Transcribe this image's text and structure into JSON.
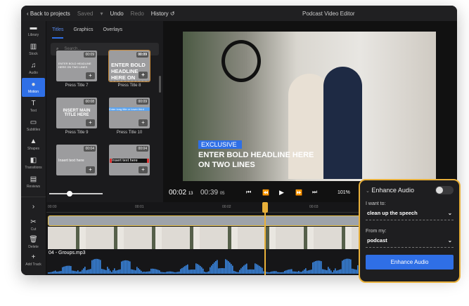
{
  "topbar": {
    "back": "Back to projects",
    "saved": "Saved",
    "undo": "Undo",
    "redo": "Redo",
    "history": "History",
    "title": "Podcast Video Editor"
  },
  "rail": [
    {
      "icon": "folder-icon",
      "glyph": "▬",
      "label": "Library"
    },
    {
      "icon": "books-icon",
      "glyph": "▥",
      "label": "Stock"
    },
    {
      "icon": "music-icon",
      "glyph": "♫",
      "label": "Audio"
    },
    {
      "icon": "motion-icon",
      "glyph": "●",
      "label": "Motion"
    },
    {
      "icon": "text-icon",
      "glyph": "T",
      "label": "Text"
    },
    {
      "icon": "subtitles-icon",
      "glyph": "▭",
      "label": "Subtitles"
    },
    {
      "icon": "shapes-icon",
      "glyph": "▲",
      "label": "Shapes"
    },
    {
      "icon": "transitions-icon",
      "glyph": "◧",
      "label": "Transitions"
    },
    {
      "icon": "reviews-icon",
      "glyph": "▤",
      "label": "Reviews"
    }
  ],
  "rail_bottom": [
    {
      "icon": "chevron-right-icon",
      "glyph": "›",
      "label": ""
    },
    {
      "icon": "scissors-icon",
      "glyph": "✂",
      "label": "Cut"
    },
    {
      "icon": "trash-icon",
      "glyph": "🗑",
      "label": "Delete"
    },
    {
      "icon": "add-track-icon",
      "glyph": "+",
      "label": "Add Track"
    }
  ],
  "panel": {
    "tabs": [
      "Titles",
      "Graphics",
      "Overlays"
    ],
    "search_placeholder": "Search...",
    "cards": [
      {
        "dur": "00:09",
        "name": "Press Title 7",
        "text": "ENTER BOLD HEADLINE HERE ON TWO LINES"
      },
      {
        "dur": "00:09",
        "name": "Press Title 8",
        "text": "ENTER BOLD HEADLINE HERE ON TWO LINES"
      },
      {
        "dur": "00:08",
        "name": "Press Title 9",
        "text": "INSERT MAIN TITLE HERE"
      },
      {
        "dur": "00:09",
        "name": "Press Title 10",
        "text": "Enter long title or lower third"
      },
      {
        "dur": "00:04",
        "name": "",
        "text": "Insert text here"
      },
      {
        "dur": "00:04",
        "name": "",
        "text": "Insert text here"
      }
    ]
  },
  "preview": {
    "badge": "EXCLUSIVE",
    "headline": "ENTER BOLD HEADLINE HERE ON TWO LINES",
    "time_current": "00:02",
    "time_current_frames": "13",
    "time_total": "00:39",
    "time_total_frames": "05",
    "zoom": "101%"
  },
  "timeline": {
    "ticks": [
      "00:00",
      "00:01",
      "00:02",
      "00:03"
    ],
    "audio_file": "04 - Groups.mp3"
  },
  "enhance": {
    "title": "Enhance Audio",
    "toggle_on": false,
    "want_label": "I want to:",
    "want_value": "clean up the speech",
    "from_label": "From my:",
    "from_value": "podcast",
    "button": "Enhance Audio"
  },
  "colors": {
    "accent": "#2f6fe6",
    "highlight": "#e8b03a"
  }
}
